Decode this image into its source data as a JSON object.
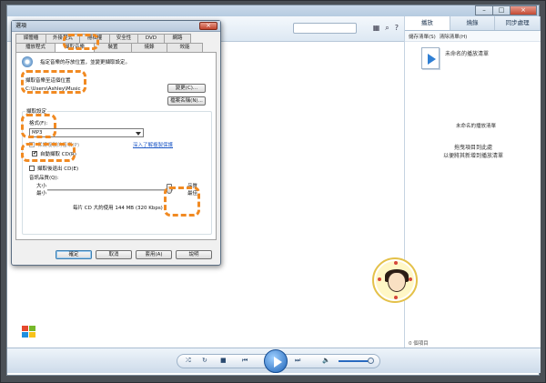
{
  "player": {
    "right_tabs": [
      "播放",
      "燒錄",
      "同步處理"
    ],
    "save_list": "儲存清單(S)",
    "clear_list": "清除清單(H)",
    "untitled_playlist": "未命名的播放清單",
    "untitled_playlist_sub": "未命名的播放清單",
    "drag_tip_1": "拖曳項目到此處",
    "drag_tip_2": "以便將其新增到播放清單",
    "item_count": "0 個項目"
  },
  "dialog": {
    "title": "選項",
    "close_symbol": "×",
    "tabs_row1": [
      "媒體櫃",
      "外掛程式",
      "隱私權",
      "安全性",
      "DVD",
      "網路"
    ],
    "tabs_row2": [
      "播放程式",
      "擷取音樂",
      "裝置",
      "燒錄",
      "效能"
    ],
    "active_tab": "擷取音樂",
    "description": "指定音樂的存放位置，並變更擷取設定。",
    "rip_location_label": "擷取音樂至這個位置",
    "rip_location_path": "C:\\Users\\Ashley\\Music",
    "change_button": "變更(C)...",
    "filename_button": "檔案名稱(N)...",
    "rip_settings_label": "擷取設定",
    "format_label": "格式(F):",
    "format_value": "MP3",
    "copy_protect_label": "保護複製的音樂(P)",
    "copy_protect_link": "深入了解複製保護",
    "auto_rip_label": "自動擷取 CD(R)",
    "auto_rip_checked": "✔",
    "eject_label": "擷取後退出 CD(E)",
    "quality_label": "音訊品質(Q):",
    "quality_min_1": "大小",
    "quality_min_2": "最小",
    "quality_max_1": "品質",
    "quality_max_2": "最佳",
    "quality_level": 0.97,
    "quality_note": "每片 CD 大約使用 144 MB (320 Kbps)",
    "ok_button": "確定",
    "cancel_button": "取消",
    "apply_button": "套用(A)",
    "help_button": "說明"
  },
  "colors": {
    "highlight": "#f18a22",
    "link": "#1f59c6",
    "accent": "#2f7fd4"
  }
}
